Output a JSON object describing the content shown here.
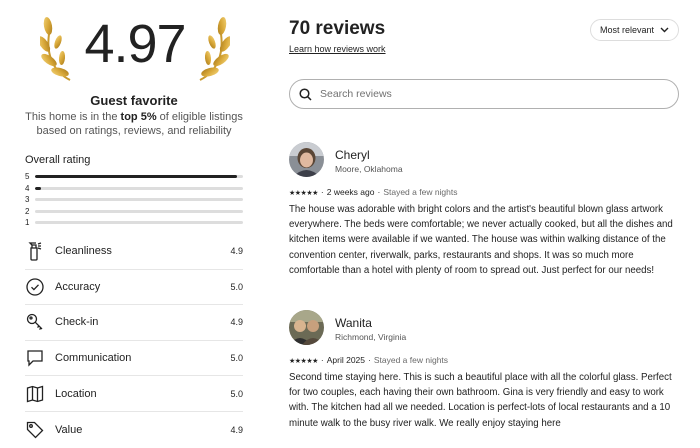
{
  "summary": {
    "score": "4.97",
    "badge_title": "Guest favorite",
    "desc_pre": "This home is in the ",
    "desc_bold": "top 5%",
    "desc_post": " of eligible listings",
    "desc_line2": "based on ratings, reviews, and reliability"
  },
  "overall": {
    "title": "Overall rating",
    "bars": [
      {
        "label": "5",
        "fraction": 0.97
      },
      {
        "label": "4",
        "fraction": 0.03
      },
      {
        "label": "3",
        "fraction": 0
      },
      {
        "label": "2",
        "fraction": 0
      },
      {
        "label": "1",
        "fraction": 0
      }
    ]
  },
  "categories": [
    {
      "name": "Cleanliness",
      "value": "4.9",
      "icon": "spray-bottle-icon"
    },
    {
      "name": "Accuracy",
      "value": "5.0",
      "icon": "check-circle-icon"
    },
    {
      "name": "Check-in",
      "value": "4.9",
      "icon": "key-icon"
    },
    {
      "name": "Communication",
      "value": "5.0",
      "icon": "message-icon"
    },
    {
      "name": "Location",
      "value": "5.0",
      "icon": "map-icon"
    },
    {
      "name": "Value",
      "value": "4.9",
      "icon": "tag-icon"
    }
  ],
  "reviews_header": {
    "title": "70 reviews",
    "learn_link": "Learn how reviews work",
    "sort_label": "Most relevant"
  },
  "search": {
    "placeholder": "Search reviews"
  },
  "reviews": [
    {
      "name": "Cheryl",
      "location": "Moore, Oklahoma",
      "stars": "★★★★★",
      "time": "2 weeks ago",
      "stay": "Stayed a few nights",
      "text": "The house was adorable with bright colors and the artist's beautiful blown glass artwork everywhere.  The beds were comfortable; we never actually cooked, but all the dishes and kitchen items were available if we wanted.  The house was within walking distance of the convention center, riverwalk, parks, restaurants and shops.  It was so much more comfortable than a hotel with plenty of room to spread out.  Just perfect for our needs!"
    },
    {
      "name": "Wanita",
      "location": "Richmond, Virginia",
      "stars": "★★★★★",
      "time": "April 2025",
      "stay": "Stayed a few nights",
      "text": "Second time staying here.  This is such a beautiful place with all the colorful glass.  Perfect for two couples, each having their own bathroom.  Gina is very friendly and easy to work with.  The kitchen had all we needed.  Location is perfect-lots of local restaurants and a 10 minute walk to the busy river walk.  We really enjoy staying here"
    }
  ],
  "colors": {
    "text": "#222222",
    "muted": "#717171",
    "laurel_gold": "#d9a93a",
    "bar_track": "#dddddd"
  }
}
